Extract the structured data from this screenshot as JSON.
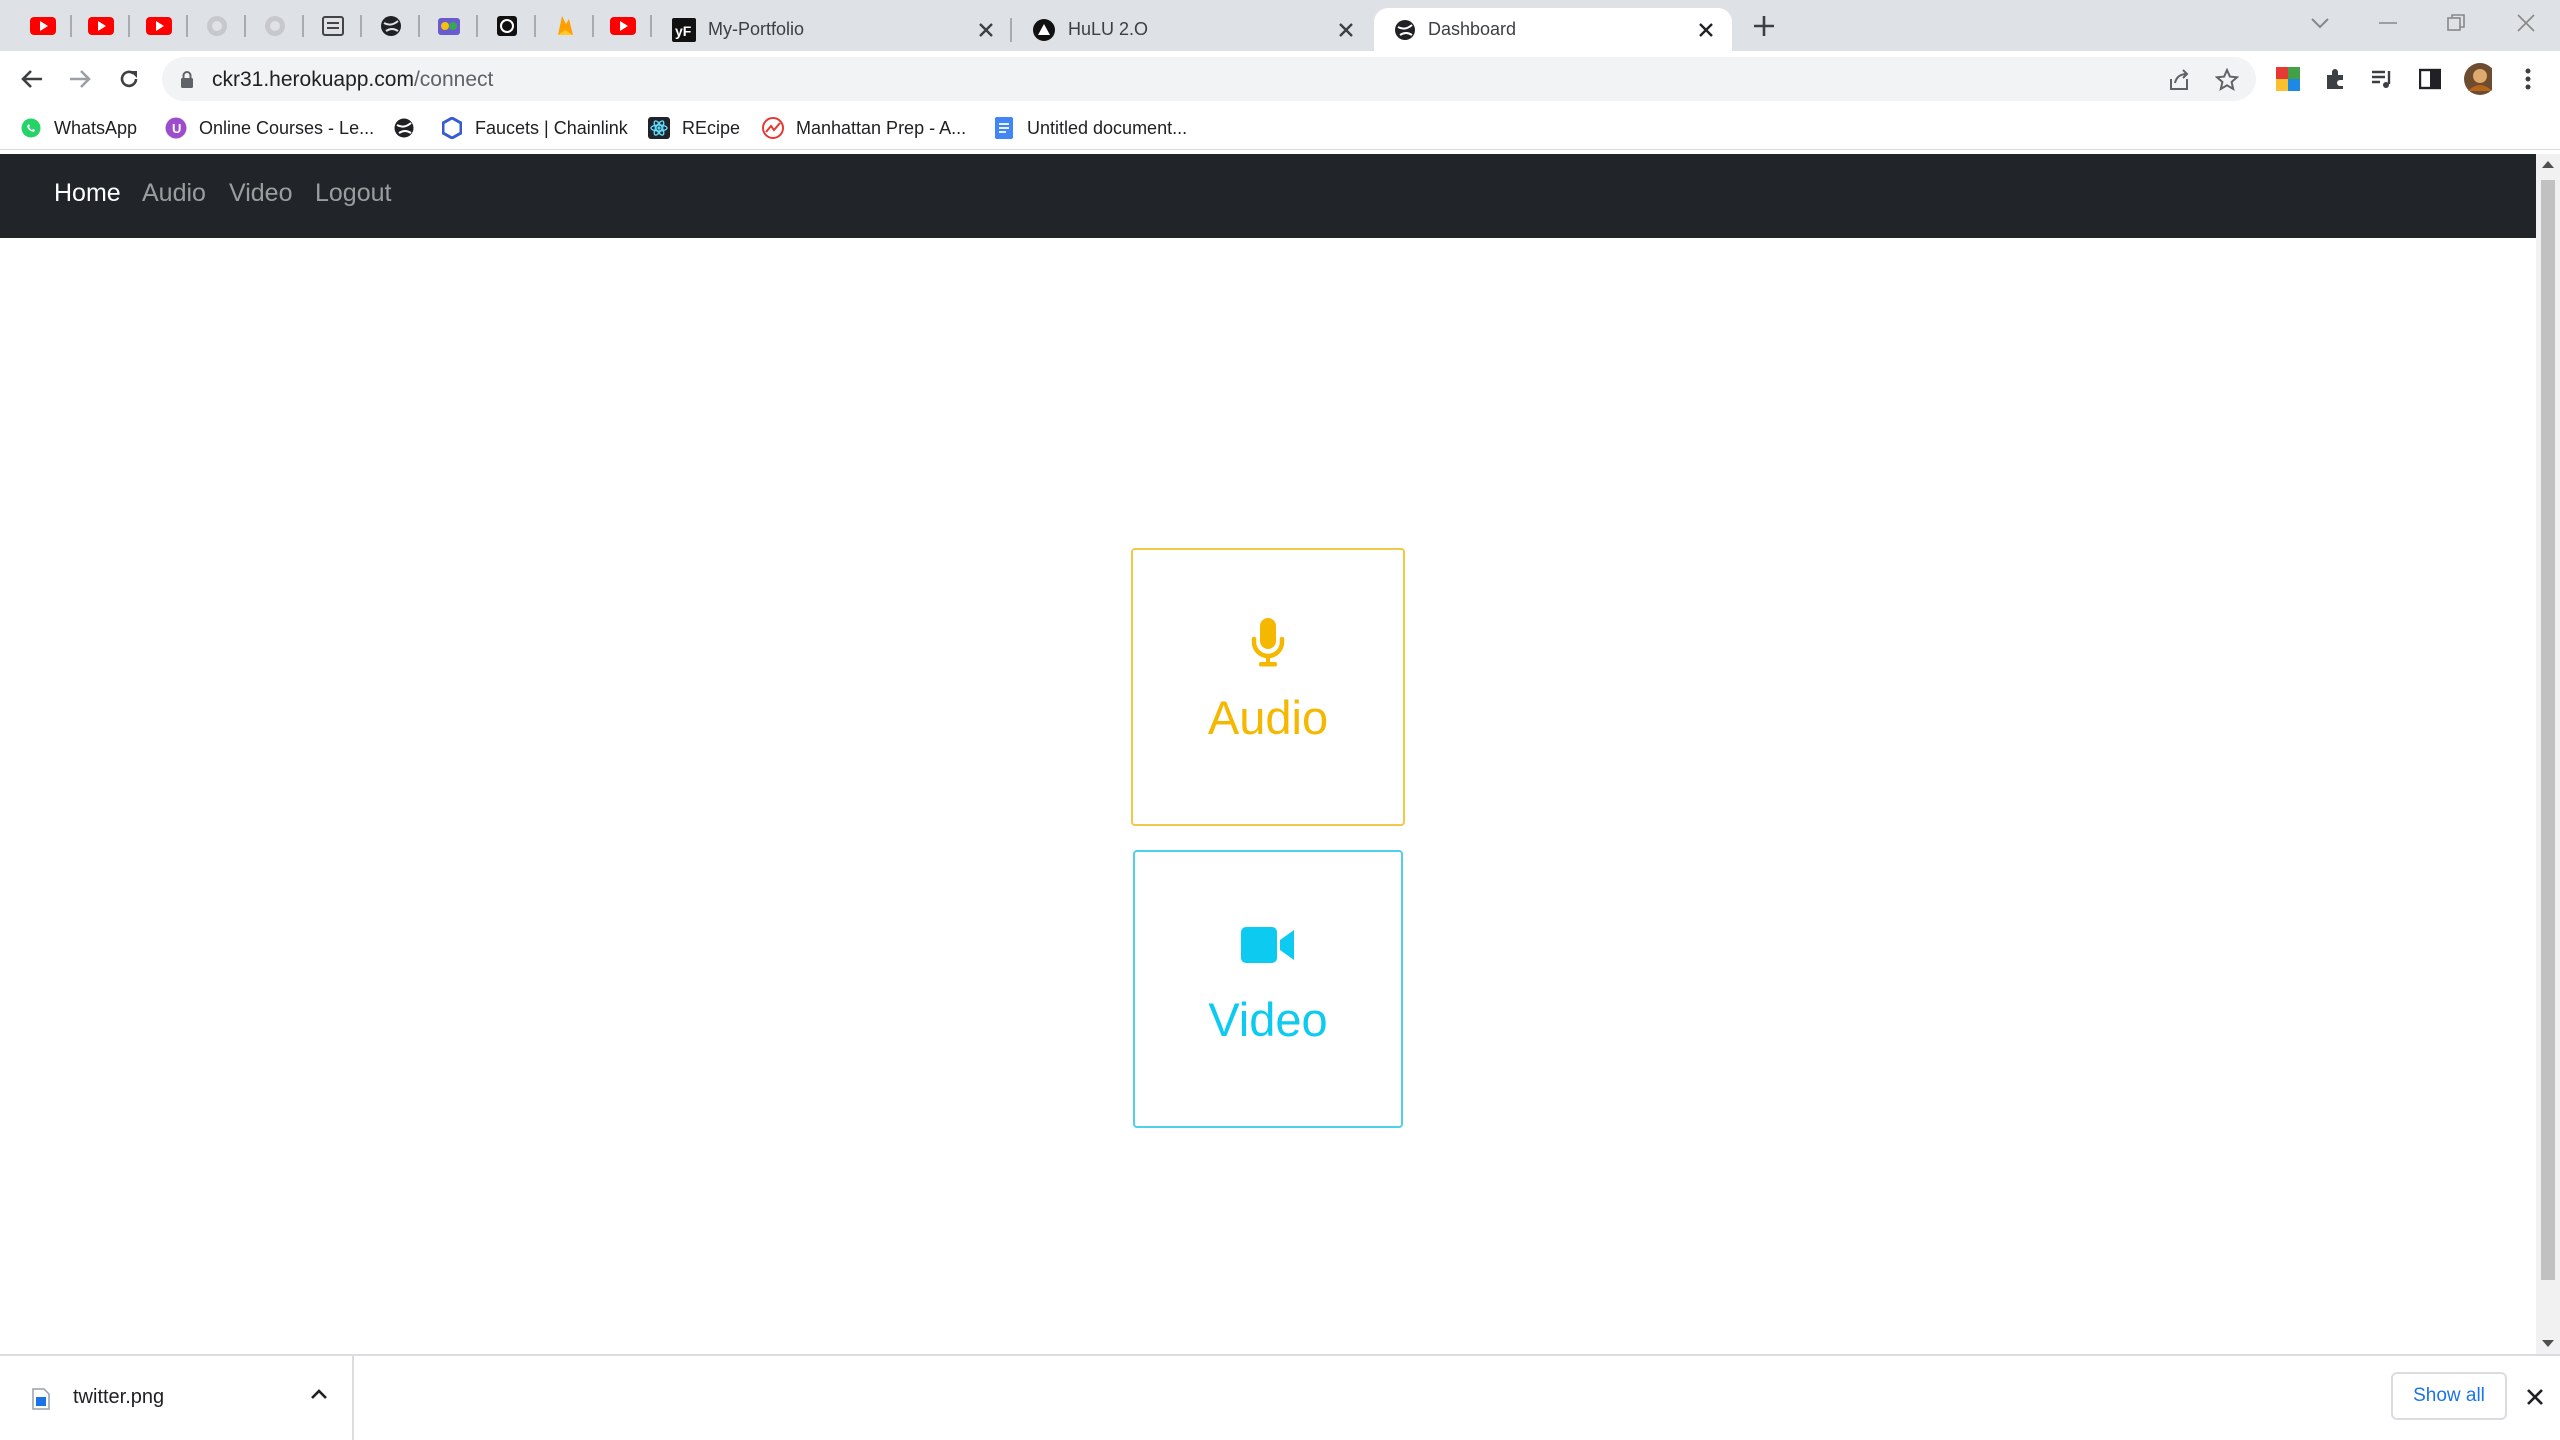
{
  "browser": {
    "tabs": [
      {
        "title": "My-Portfolio",
        "icon": "yf-logo-icon"
      },
      {
        "title": "HuLU 2.O",
        "icon": "triangle-logo-icon"
      },
      {
        "title": "Dashboard",
        "icon": "globe-icon",
        "active": true
      }
    ],
    "pinned_tab_icons": [
      "youtube-icon",
      "youtube-icon",
      "youtube-icon",
      "globe-icon",
      "globe-icon",
      "graduation-icon",
      "globe-icon",
      "app-icon",
      "app-icon",
      "firebase-icon",
      "youtube-icon"
    ],
    "url": {
      "host": "ckr31.herokuapp.com",
      "path": "/connect"
    },
    "bookmarks": [
      {
        "label": "WhatsApp",
        "icon": "whatsapp-icon"
      },
      {
        "label": "Online Courses - Le...",
        "icon": "courses-icon"
      },
      {
        "label": "",
        "icon": "globe-icon"
      },
      {
        "label": "Faucets | Chainlink",
        "icon": "chainlink-icon"
      },
      {
        "label": "REcipe",
        "icon": "react-icon"
      },
      {
        "label": "Manhattan Prep - A...",
        "icon": "chart-icon"
      },
      {
        "label": "Untitled document...",
        "icon": "docs-icon"
      }
    ]
  },
  "site": {
    "nav": {
      "home": "Home",
      "audio": "Audio",
      "video": "Video",
      "logout": "Logout"
    },
    "cards": {
      "audio": {
        "label": "Audio",
        "icon": "microphone-icon",
        "color": "#f5b800"
      },
      "video": {
        "label": "Video",
        "icon": "video-camera-icon",
        "color": "#0dcaf0"
      }
    }
  },
  "downloads": {
    "file": "twitter.png",
    "show_all": "Show all"
  }
}
